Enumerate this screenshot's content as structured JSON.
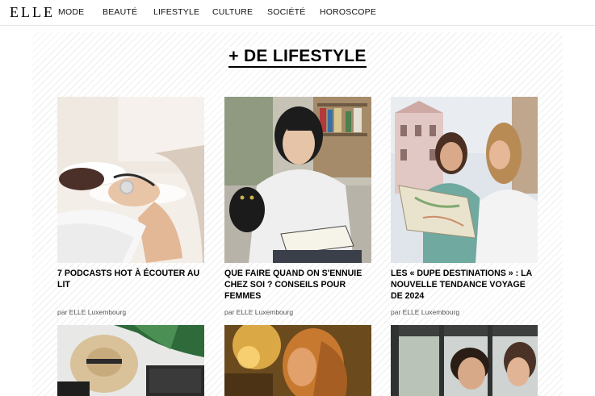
{
  "brand": {
    "logo": "ELLE"
  },
  "nav": {
    "items": [
      {
        "label": "MODE"
      },
      {
        "label": "BEAUTÉ"
      },
      {
        "label": "LIFESTYLE"
      },
      {
        "label": "CULTURE"
      },
      {
        "label": "SOCIÉTÉ"
      },
      {
        "label": "HOROSCOPE"
      }
    ]
  },
  "section": {
    "title": "+ DE LIFESTYLE"
  },
  "articles": [
    {
      "title": "7 PODCASTS HOT À ÉCOUTER AU LIT",
      "author": "par ELLE Luxembourg",
      "image": "woman-with-headphones-on-bed"
    },
    {
      "title": "QUE FAIRE QUAND ON S'ENNUIE CHEZ SOI ? CONSEILS POUR FEMMES",
      "author": "par ELLE Luxembourg",
      "image": "girl-with-cat-and-book"
    },
    {
      "title": "LES « DUPE DESTINATIONS » : LA NOUVELLE TENDANCE VOYAGE DE 2024",
      "author": "par ELLE Luxembourg",
      "image": "two-women-with-map"
    }
  ],
  "next_row": [
    {
      "image": "travel-hat-and-suitcase"
    },
    {
      "image": "woman-in-sunset-light"
    },
    {
      "image": "two-people-at-window"
    }
  ]
}
